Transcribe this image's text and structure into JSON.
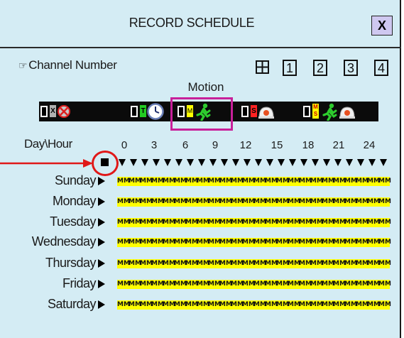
{
  "dialog": {
    "title": "RECORD SCHEDULE",
    "close_label": "X"
  },
  "channel": {
    "label": "Channel Number",
    "buttons": [
      "1",
      "2",
      "3",
      "4"
    ],
    "all_icon": "quad-grid-icon"
  },
  "modes": {
    "motion_label": "Motion",
    "items": [
      {
        "name": "no-record",
        "tag": "X",
        "tag_color": "#b0b0b0",
        "icon": "no-record-icon"
      },
      {
        "name": "timer",
        "tag": "T",
        "tag_color": "#22cc22",
        "icon": "clock-icon"
      },
      {
        "name": "motion",
        "tag": "M",
        "tag_color": "#ffff00",
        "icon": "running-man-icon"
      },
      {
        "name": "sensor",
        "tag": "S",
        "tag_color": "#ff2222",
        "icon": "alarm-bell-icon"
      },
      {
        "name": "motion-sensor",
        "tag": "M S",
        "tag_color": "#ffff00",
        "icon": "running-man-bell-icon"
      }
    ]
  },
  "grid": {
    "header": "Day\\Hour",
    "hours": [
      "0",
      "3",
      "6",
      "9",
      "12",
      "15",
      "18",
      "21",
      "24"
    ],
    "days": [
      "Sunday",
      "Monday",
      "Tuesday",
      "Wednesday",
      "Thursday",
      "Friday",
      "Saturday"
    ],
    "cell_value": "M",
    "cell_color": "#ffff00",
    "hours_per_day": 24
  },
  "colors": {
    "background": "#d4ecf4",
    "highlight": "#c8209a",
    "callout": "#e01818"
  }
}
